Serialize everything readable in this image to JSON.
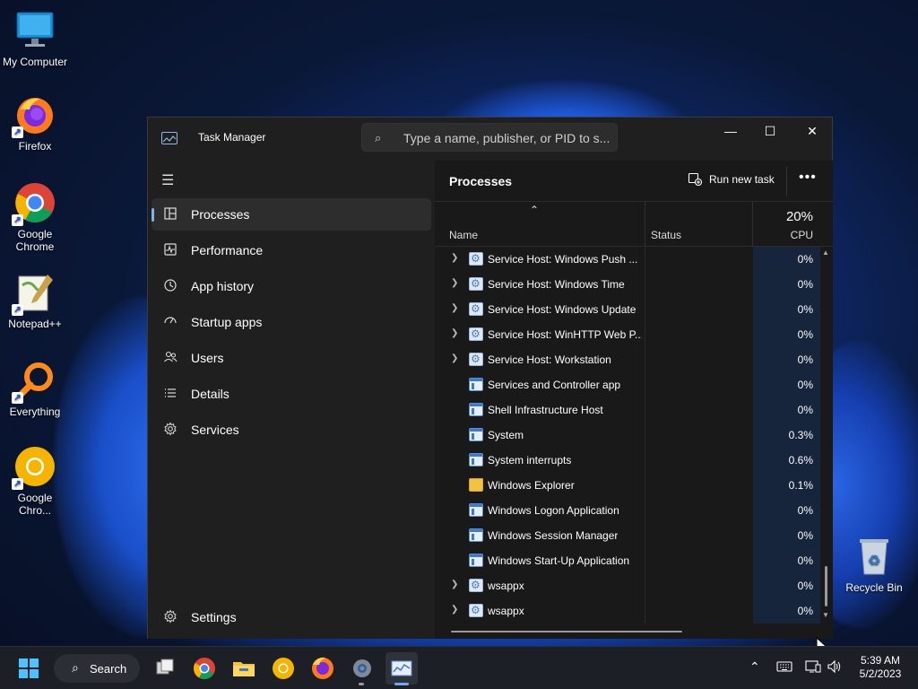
{
  "desktop": {
    "icons": [
      {
        "label": "My Computer"
      },
      {
        "label": "Firefox"
      },
      {
        "label": "Google Chrome"
      },
      {
        "label": "Notepad++"
      },
      {
        "label": "Everything"
      },
      {
        "label": "Google Chro..."
      },
      {
        "label": "Recycle Bin"
      }
    ]
  },
  "window": {
    "title": "Task Manager",
    "search_placeholder": "Type a name, publisher, or PID to s...",
    "controls": {
      "minimize": "—",
      "maximize": "☐",
      "close": "✕"
    }
  },
  "sidebar": {
    "items": [
      {
        "label": "Processes",
        "icon": "processes-icon",
        "active": true
      },
      {
        "label": "Performance",
        "icon": "performance-icon"
      },
      {
        "label": "App history",
        "icon": "app-history-icon"
      },
      {
        "label": "Startup apps",
        "icon": "startup-apps-icon"
      },
      {
        "label": "Users",
        "icon": "users-icon"
      },
      {
        "label": "Details",
        "icon": "details-icon"
      },
      {
        "label": "Services",
        "icon": "services-icon"
      }
    ],
    "settings_label": "Settings"
  },
  "content": {
    "title": "Processes",
    "run_new_task": "Run new task",
    "more": "•••",
    "columns": {
      "name": "Name",
      "status": "Status",
      "cpu_total": "20%",
      "cpu": "CPU"
    },
    "rows": [
      {
        "name": "Service Host: Windows Push ...",
        "cpu": "0%",
        "expandable": true,
        "icon": "service"
      },
      {
        "name": "Service Host: Windows Time",
        "cpu": "0%",
        "expandable": true,
        "icon": "service"
      },
      {
        "name": "Service Host: Windows Update",
        "cpu": "0%",
        "expandable": true,
        "icon": "service"
      },
      {
        "name": "Service Host: WinHTTP Web P...",
        "cpu": "0%",
        "expandable": true,
        "icon": "service"
      },
      {
        "name": "Service Host: Workstation",
        "cpu": "0%",
        "expandable": true,
        "icon": "service"
      },
      {
        "name": "Services and Controller app",
        "cpu": "0%",
        "expandable": false,
        "icon": "app"
      },
      {
        "name": "Shell Infrastructure Host",
        "cpu": "0%",
        "expandable": false,
        "icon": "app"
      },
      {
        "name": "System",
        "cpu": "0.3%",
        "expandable": false,
        "icon": "app"
      },
      {
        "name": "System interrupts",
        "cpu": "0.6%",
        "expandable": false,
        "icon": "app"
      },
      {
        "name": "Windows Explorer",
        "cpu": "0.1%",
        "expandable": false,
        "icon": "folder"
      },
      {
        "name": "Windows Logon Application",
        "cpu": "0%",
        "expandable": false,
        "icon": "app"
      },
      {
        "name": "Windows Session Manager",
        "cpu": "0%",
        "expandable": false,
        "icon": "app"
      },
      {
        "name": "Windows Start-Up Application",
        "cpu": "0%",
        "expandable": false,
        "icon": "app"
      },
      {
        "name": "wsappx",
        "cpu": "0%",
        "expandable": true,
        "icon": "service"
      },
      {
        "name": "wsappx",
        "cpu": "0%",
        "expandable": true,
        "icon": "service"
      }
    ]
  },
  "taskbar": {
    "search_label": "Search",
    "time": "5:39 AM",
    "date": "5/2/2023"
  },
  "colors": {
    "accent": "#7cb4f0",
    "cpu_highlight": "#16243c",
    "window_bg": "#1f1f1f"
  }
}
